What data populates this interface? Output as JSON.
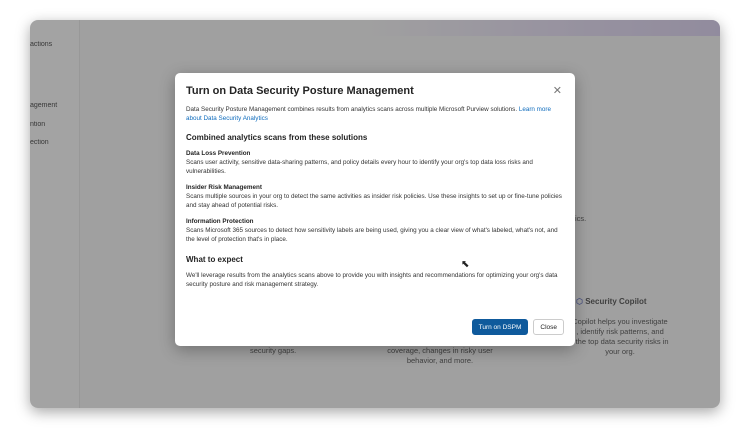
{
  "sidebar": {
    "items": [
      "actions",
      "agement",
      "ntion",
      "ection"
    ]
  },
  "background": {
    "copilot_title": "Security Copilot",
    "copilot_text": [
      "Copilot helps you investigate",
      ", identify risk patterns, and",
      "t the top data security risks in",
      "your org."
    ],
    "col1_text": "security gaps.",
    "col2_text": [
      "coverage, changes in risky user",
      "behavior, and more."
    ],
    "ics": "ics."
  },
  "dialog": {
    "title": "Turn on Data Security Posture Management",
    "intro": "Data Security Posture Management combines results from analytics scans across multiple Microsoft Purview solutions. ",
    "learn_more": "Learn more about Data Security Analytics",
    "section_heading": "Combined analytics scans from these solutions",
    "solutions": [
      {
        "name": "Data Loss Prevention",
        "desc": "Scans user activity, sensitive data-sharing patterns, and policy details every hour to identify your org's top data loss risks and vulnerabilities."
      },
      {
        "name": "Insider Risk Management",
        "desc": "Scans multiple sources in your org to detect the same activities as insider risk policies. Use these insights to set up or fine-tune policies and stay ahead of potential risks."
      },
      {
        "name": "Information Protection",
        "desc": "Scans Microsoft 365 sources to detect how sensitivity labels are being used, giving you a clear view of what's labeled, what's not, and the level of protection that's in place."
      }
    ],
    "expect_heading": "What to expect",
    "expect_text": "We'll leverage results from the analytics scans above to provide you with insights and recommendations for optimizing your org's data security posture and risk management strategy.",
    "primary_button": "Turn on DSPM",
    "close_button": "Close"
  }
}
